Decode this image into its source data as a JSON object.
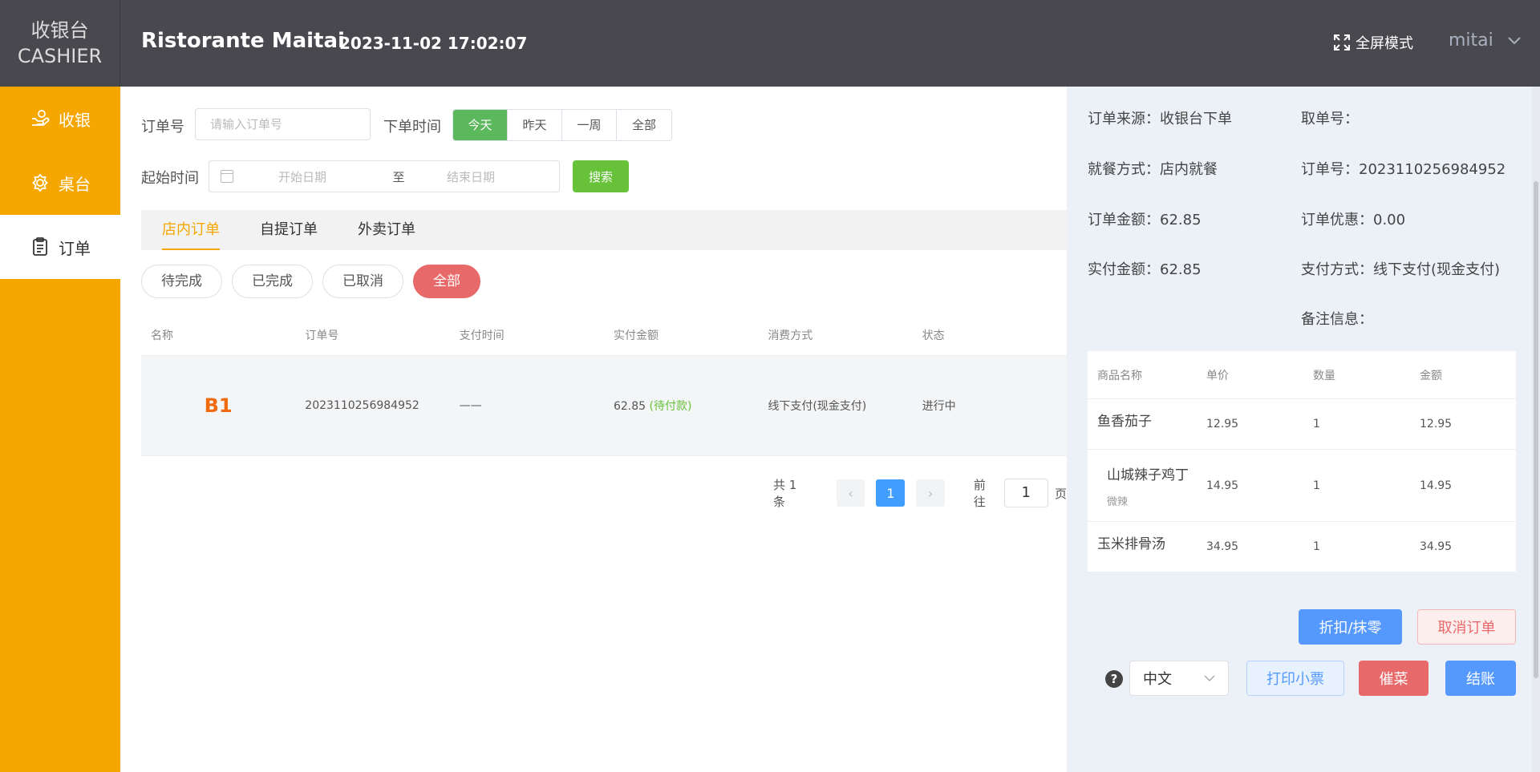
{
  "header": {
    "logo_cn": "收银台",
    "logo_en": "CASHIER",
    "store_name": "Ristorante Maitai",
    "datetime": "2023-11-02 17:02:07",
    "fullscreen_label": "全屏模式",
    "user_name": "mitai"
  },
  "sidebar": {
    "items": [
      {
        "label": "收银",
        "icon": "cashier-icon"
      },
      {
        "label": "桌台",
        "icon": "table-icon"
      },
      {
        "label": "订单",
        "icon": "order-icon"
      }
    ]
  },
  "filters": {
    "order_no_label": "订单号",
    "order_no_placeholder": "请输入订单号",
    "order_time_label": "下单时间",
    "time_options": [
      "今天",
      "昨天",
      "一周",
      "全部"
    ],
    "time_selected": "今天",
    "start_time_label": "起始时间",
    "start_placeholder": "开始日期",
    "range_sep": "至",
    "end_placeholder": "结束日期",
    "search_label": "搜索"
  },
  "tabs": [
    "店内订单",
    "自提订单",
    "外卖订单"
  ],
  "status_pills": [
    "待完成",
    "已完成",
    "已取消",
    "全部"
  ],
  "table": {
    "headers": [
      "名称",
      "订单号",
      "支付时间",
      "实付金额",
      "消费方式",
      "状态"
    ],
    "rows": [
      {
        "name": "B1",
        "order_no": "2023110256984952",
        "pay_time": "——",
        "amount": "62.85",
        "amount_status": "(待付款)",
        "method": "线下支付(现金支付)",
        "status": "进行中"
      }
    ]
  },
  "pager": {
    "total": "共 1 条",
    "current": "1",
    "goto_label": "前往",
    "goto_value": "1",
    "page_suffix": "页"
  },
  "detail": {
    "source": "订单来源：收银台下单",
    "pickup_no": "取单号：",
    "dine_method": "就餐方式：店内就餐",
    "order_no": "订单号：2023110256984952",
    "order_amount": "订单金额：62.85",
    "discount": "订单优惠：0.00",
    "paid_amount": "实付金额：62.85",
    "pay_method": "支付方式：线下支付(现金支付)",
    "remark": "备注信息：",
    "items_headers": [
      "商品名称",
      "单价",
      "数量",
      "金额"
    ],
    "items": [
      {
        "name": "鱼香茄子",
        "spec": "",
        "price": "12.95",
        "qty": "1",
        "total": "12.95"
      },
      {
        "name": "山城辣子鸡丁",
        "spec": "微辣",
        "price": "14.95",
        "qty": "1",
        "total": "14.95"
      },
      {
        "name": "玉米排骨汤",
        "spec": "",
        "price": "34.95",
        "qty": "1",
        "total": "34.95"
      }
    ],
    "btn_discount": "折扣/抹零",
    "btn_cancel": "取消订单",
    "help": "?",
    "language": "中文",
    "btn_print": "打印小票",
    "btn_urge": "催菜",
    "btn_checkout": "结账"
  }
}
